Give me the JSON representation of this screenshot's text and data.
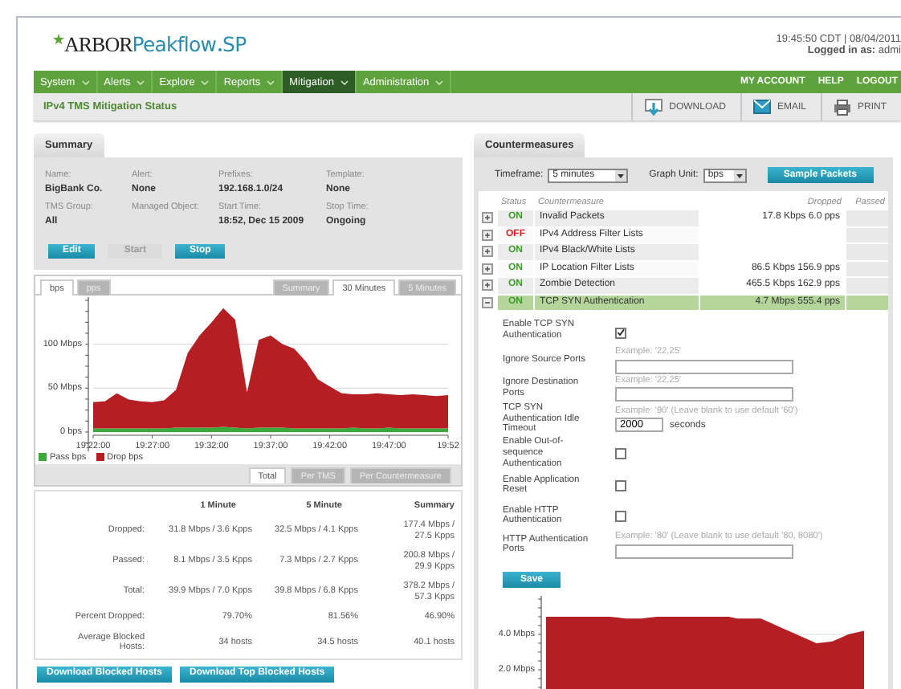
{
  "header": {
    "logo": {
      "brand": "ARBOR",
      "product": "Peakflow",
      "edition": "SP"
    },
    "clock": "19:45:50 CDT | 08/04/2011",
    "login": "**Logged in as:** admi"
  },
  "nav": {
    "items": [
      {
        "label": "System",
        "selected": false
      },
      {
        "label": "Alerts",
        "selected": false
      },
      {
        "label": "Explore",
        "selected": false
      },
      {
        "label": "Reports",
        "selected": false
      },
      {
        "label": "Mitigation",
        "selected": true
      },
      {
        "label": "Administration",
        "selected": false
      }
    ],
    "links": [
      "MY ACCOUNT",
      "HELP",
      "LOGOUT"
    ]
  },
  "page": {
    "title": "IPv4 TMS Mitigation Status",
    "actions": [
      {
        "label": "DOWNLOAD",
        "kind": "download"
      },
      {
        "label": "EMAIL",
        "kind": "email"
      },
      {
        "label": "PRINT",
        "kind": "print"
      }
    ]
  },
  "summary": {
    "tab": "Summary",
    "fields": [
      {
        "label": "Name:",
        "value": "BigBank Co."
      },
      {
        "label": "Alert:",
        "value": "None"
      },
      {
        "label": "Prefixes:",
        "value": "192.168.1.0/24"
      },
      {
        "label": "Template:",
        "value": "None"
      },
      {
        "label": "TMS Group:",
        "value": "All"
      },
      {
        "label": "Managed Object:"
      },
      {
        "label": "Start Time:",
        "value": "18:52, Dec 15 2009"
      },
      {
        "label": "Stop Time:",
        "value": "Ongoing"
      }
    ],
    "buttons": [
      {
        "label": "Edit",
        "disabled": false
      },
      {
        "label": "Start",
        "disabled": true
      },
      {
        "label": "Stop",
        "disabled": false
      }
    ],
    "unit_tabs": [
      {
        "label": "bps",
        "selected": true
      },
      {
        "label": "pps",
        "selected": false
      }
    ],
    "range_tabs": [
      {
        "label": "Summary",
        "selected": false
      },
      {
        "label": "30 Minutes",
        "selected": true
      },
      {
        "label": "5 Minutes",
        "selected": false
      }
    ],
    "chart_data": {
      "type": "area",
      "stacked": true,
      "categories": [
        "19:22:00",
        null,
        null,
        null,
        null,
        "19:27:00",
        null,
        null,
        null,
        null,
        "19:32:00",
        null,
        null,
        null,
        null,
        "19:37:00",
        null,
        null,
        null,
        null,
        "19:42:00",
        null,
        null,
        null,
        null,
        "19:47:00",
        null,
        null,
        null,
        null,
        "19:52"
      ],
      "ylim": [
        0,
        150
      ],
      "yticks": [
        {
          "value": 0,
          "label": "0 bps"
        },
        {
          "value": 50,
          "label": "50 Mbps"
        },
        {
          "value": 100,
          "label": "100 Mbps"
        }
      ],
      "series": [
        {
          "name": "Pass bps",
          "color": "#3aa83a",
          "values": [
            4,
            4,
            4,
            4,
            4,
            4,
            4,
            5,
            5,
            5,
            5,
            6,
            5,
            4,
            5,
            5,
            5,
            4,
            4,
            4,
            4,
            4,
            5,
            4,
            4,
            5,
            4,
            4,
            4,
            4,
            4
          ]
        },
        {
          "name": "Drop bps",
          "color": "#b51f24",
          "values": [
            30,
            31,
            40,
            33,
            31,
            30,
            32,
            43,
            85,
            105,
            120,
            135,
            123,
            41,
            100,
            105,
            95,
            91,
            76,
            56,
            48,
            40,
            38,
            39,
            40,
            38,
            38,
            39,
            38,
            37,
            38
          ]
        }
      ]
    },
    "breakdown_tabs": [
      {
        "label": "Total",
        "selected": true
      },
      {
        "label": "Per TMS",
        "selected": false
      },
      {
        "label": "Per Countermeasure",
        "selected": false
      }
    ],
    "stats": {
      "columns": [
        "1 Minute",
        "5 Minute",
        "Summary"
      ],
      "rows": [
        {
          "label": "Dropped:",
          "values": [
            "31.8 Mbps / 3.6 Kpps",
            "32.5 Mbps / 4.1 Kpps",
            "177.4 Mbps / 27.5 Kpps"
          ]
        },
        {
          "label": "Passed:",
          "values": [
            "8.1 Mbps / 3.5 Kpps",
            "7.3 Mbps / 2.7 Kpps",
            "200.8 Mbps / 29.9 Kpps"
          ]
        },
        {
          "label": "Total:",
          "values": [
            "39.9 Mbps / 7.0 Kpps",
            "39.8 Mbps / 6.8 Kpps",
            "378.2 Mbps / 57.3 Kpps"
          ]
        },
        {
          "label": "Percent Dropped:",
          "values": [
            "79.70%",
            "81.56%",
            "46.90%"
          ]
        },
        {
          "label": "Average Blocked Hosts:",
          "values": [
            "34  hosts",
            "34.5  hosts",
            "40.1  hosts"
          ]
        }
      ]
    },
    "downloads": [
      "Download Blocked Hosts",
      "Download Top Blocked Hosts"
    ]
  },
  "countermeasures": {
    "tab": "Countermeasures",
    "timeframe": {
      "label": "Timeframe:",
      "value": "5 minutes"
    },
    "graph_unit": {
      "label": "Graph Unit:",
      "value": "bps"
    },
    "sample_button": "Sample Packets",
    "columns": [
      "Status",
      "Countermeasure",
      "Dropped",
      "Passed"
    ],
    "rows": [
      {
        "status": "ON",
        "on": true,
        "name": "Invalid Packets",
        "dropped": "17.8 Kbps 6.0 pps",
        "expanded": false,
        "selected": false
      },
      {
        "status": "OFF",
        "on": false,
        "name": "IPv4 Address Filter Lists",
        "expanded": false,
        "selected": false
      },
      {
        "status": "ON",
        "on": true,
        "name": "IPv4 Black/White Lists",
        "expanded": false,
        "selected": false
      },
      {
        "status": "ON",
        "on": true,
        "name": "IP Location Filter Lists",
        "dropped": "86.5 Kbps 156.9 pps",
        "expanded": false,
        "selected": false
      },
      {
        "status": "ON",
        "on": true,
        "name": "Zombie Detection",
        "dropped": "465.5 Kbps 162.9 pps",
        "expanded": false,
        "selected": false
      },
      {
        "status": "ON",
        "on": true,
        "name": "TCP SYN Authentication",
        "dropped": "4.7 Mbps 555.4 pps",
        "expanded": true,
        "selected": true
      }
    ],
    "settings": [
      {
        "kind": "checkbox",
        "label": "Enable TCP SYN Authentication",
        "checked": true
      },
      {
        "kind": "text",
        "label": "Ignore Source Ports",
        "hint": "Example:  '22,25'"
      },
      {
        "kind": "text",
        "label": "Ignore Destination Ports",
        "hint": "Example:  '22,25'"
      },
      {
        "kind": "number",
        "label": "TCP SYN Authentication Idle Timeout",
        "hint": "Example: '90' (Leave blank to use default '60')",
        "value": "2000",
        "unit": "seconds"
      },
      {
        "kind": "checkbox",
        "label": "Enable Out-of-sequence Authentication",
        "checked": false
      },
      {
        "kind": "checkbox",
        "label": "Enable Application Reset",
        "checked": false
      },
      {
        "kind": "checkbox",
        "label": "Enable HTTP Authentication",
        "checked": false
      },
      {
        "kind": "text",
        "label": "HTTP Authentication Ports",
        "hint": "Example: '80' (Leave blank to use default '80, 8080')"
      }
    ],
    "save": "Save",
    "chart_data": {
      "type": "area",
      "ylim": [
        0,
        6
      ],
      "yticks": [
        {
          "value": 2,
          "label": "2.0 Mbps"
        },
        {
          "value": 4,
          "label": "4.0 Mbps"
        }
      ],
      "values": [
        5.0,
        5.0,
        5.0,
        5.0,
        5.0,
        5.0,
        5.0,
        5.0,
        5.0,
        4.95,
        4.9,
        4.9,
        4.9,
        4.95,
        5.0,
        5.0,
        5.0,
        5.0,
        5.0,
        5.0,
        5.0,
        5.0,
        5.0,
        5.0,
        4.9,
        4.9,
        4.9,
        4.9,
        4.7,
        4.5,
        4.3,
        4.1,
        3.9,
        3.7,
        3.5,
        3.55,
        3.6,
        3.8,
        4.0,
        4.1,
        4.2
      ]
    }
  }
}
